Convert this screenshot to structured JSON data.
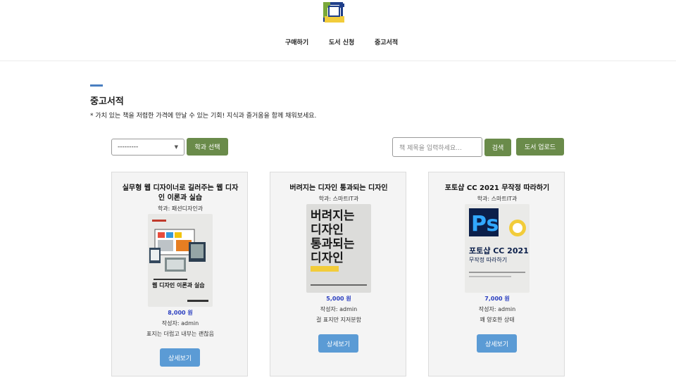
{
  "nav": {
    "items": [
      {
        "label": "구매하기"
      },
      {
        "label": "도서 신청"
      },
      {
        "label": "중고서적"
      }
    ]
  },
  "section": {
    "title": "중고서적",
    "description": "* 가치 있는 책을 저렴한 가격에 만날 수 있는 기회! 지식과 즐거움을 함께 채워보세요."
  },
  "filter": {
    "selected": "---------",
    "dept_button": "학과 선택",
    "search_placeholder": "책 제목을 입력하세요...",
    "search_button": "검색",
    "upload_button": "도서 업로드"
  },
  "books": [
    {
      "title": "실무형 웹 디자이너로 길러주는 웹 디자인 이론과 실습",
      "dept": "학과: 패션디자인과",
      "cover_text": "웹 디자인 이론과 실습",
      "price": "8,000 원",
      "author": "작성자: admin",
      "desc": "표지는 더럽고 내부는 괜찮음",
      "detail_button": "상세보기"
    },
    {
      "title": "버려지는 디자인 통과되는 디자인",
      "dept": "학과: 스마트IT과",
      "cover_text": "버려지는 디자인 통과되는 디자인",
      "price": "5,000 원",
      "author": "작성자: admin",
      "desc": "걸 표지만 지저분함",
      "detail_button": "상세보기"
    },
    {
      "title": "포토샵 CC 2021 무작정 따라하기",
      "dept": "학과: 스마트IT과",
      "cover_text": "포토샵 CC 2021 무작정 따라하기",
      "price": "7,000 원",
      "author": "작성자: admin",
      "desc": "꽤 양호한 상태",
      "detail_button": "상세보기"
    }
  ]
}
